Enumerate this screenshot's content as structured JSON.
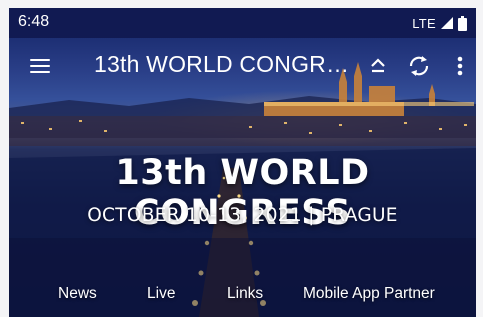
{
  "status_bar": {
    "time": "6:48",
    "network": "LTE",
    "icons": [
      "signal-icon",
      "battery-icon"
    ]
  },
  "app_bar": {
    "title": "13th WORLD CONGR…",
    "icons": [
      "menu-icon",
      "collapse-icon",
      "refresh-icon",
      "more-vertical-icon"
    ]
  },
  "hero": {
    "title": "13th WORLD CONGRESS",
    "subtitle": "OCTOBER 10-13, 2021 | PRAGUE"
  },
  "nav": {
    "tabs": [
      {
        "label": "News"
      },
      {
        "label": "Live"
      },
      {
        "label": "Links"
      },
      {
        "label": "Mobile App Partner"
      }
    ]
  },
  "colors": {
    "status_bar": "#111a52",
    "hero_deep": "#0c133a",
    "text": "#ffffff"
  }
}
